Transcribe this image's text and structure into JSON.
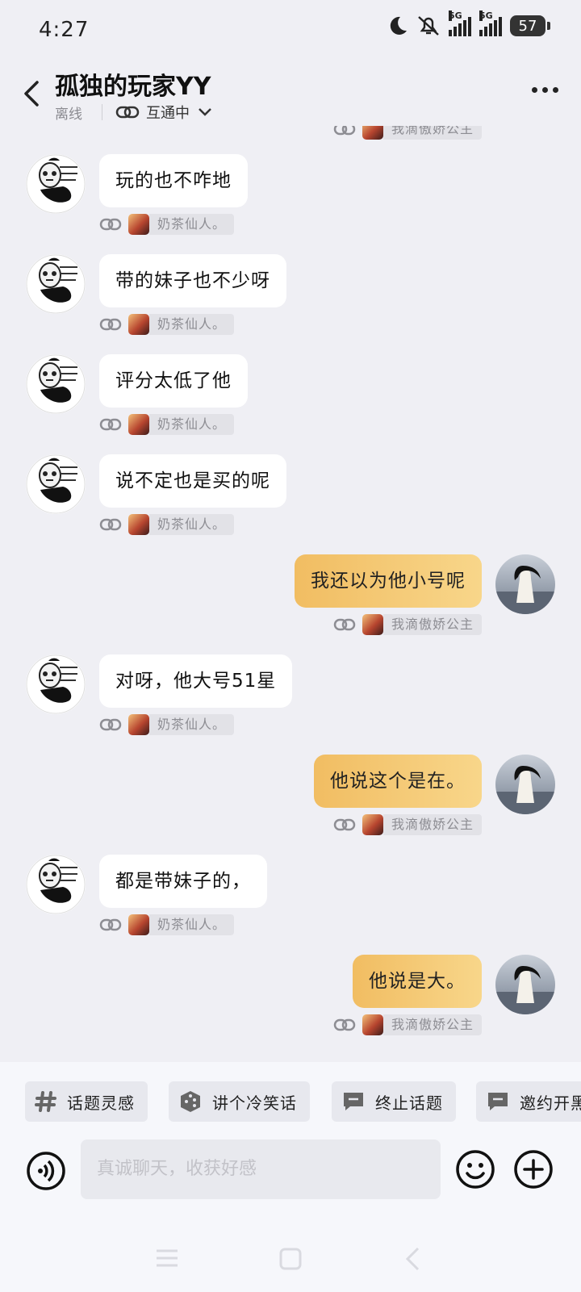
{
  "status_bar": {
    "time": "4:27",
    "battery": "57",
    "network_1": "5G",
    "network_2": "5G"
  },
  "header": {
    "title": "孤独的玩家YY",
    "presence": "离线",
    "mode": "互通中"
  },
  "messages": [
    {
      "side": "in",
      "text": "玩的也不咋地",
      "tag": "奶茶仙人。"
    },
    {
      "side": "in",
      "text": "带的妹子也不少呀",
      "tag": "奶茶仙人。"
    },
    {
      "side": "in",
      "text": "评分太低了他",
      "tag": "奶茶仙人。"
    },
    {
      "side": "in",
      "text": "说不定也是买的呢",
      "tag": "奶茶仙人。"
    },
    {
      "side": "out",
      "text": "我还以为他小号呢",
      "tag": "我滴傲娇公主"
    },
    {
      "side": "in",
      "text": "对呀，他大号51星",
      "tag": "奶茶仙人。"
    },
    {
      "side": "out",
      "text": "他说这个是在。",
      "tag": "我滴傲娇公主"
    },
    {
      "side": "in",
      "text": "都是带妹子的，",
      "tag": "奶茶仙人。"
    },
    {
      "side": "out",
      "text": "他说是大。",
      "tag": "我滴傲娇公主"
    }
  ],
  "top_partial_tag": "我滴傲娇公主",
  "chips": [
    {
      "label": "话题灵感",
      "icon": "hashtag-icon"
    },
    {
      "label": "讲个冷笑话",
      "icon": "dice-icon"
    },
    {
      "label": "终止话题",
      "icon": "chat-bubble-icon"
    },
    {
      "label": "邀约开黑",
      "icon": "chat-bubble-icon"
    }
  ],
  "input": {
    "placeholder": "真诚聊天，收获好感"
  },
  "colors": {
    "outgoing_bubble": "#f4c670",
    "background": "#efeff4"
  }
}
